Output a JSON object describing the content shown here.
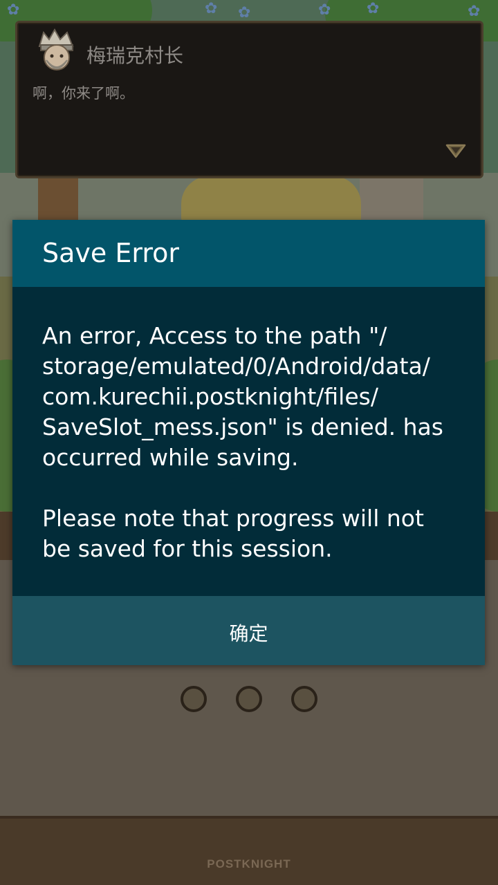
{
  "dialogue": {
    "speaker_name": "梅瑞克村长",
    "speech_text": "啊，你来了啊。"
  },
  "modal": {
    "title": "Save Error",
    "message": "An error, Access to the path \"/\nstorage/emulated/0/Android/data/\ncom.kurechii.postknight/files/\nSaveSlot_mess.json\" is denied. has\noccurred while saving.\n\nPlease note that progress will not\nbe saved for this session.",
    "ok_label": "确定"
  },
  "footer": {
    "brand": "POSTKNIGHT"
  },
  "colors": {
    "modal_header": "#02556a",
    "modal_body": "#022c39",
    "modal_footer": "#1d5461",
    "dialogue_bg": "#1a1714"
  },
  "icons": {
    "avatar": "village-chief-avatar-icon",
    "next": "triangle-down-icon"
  },
  "page_dots": {
    "count": 3
  }
}
